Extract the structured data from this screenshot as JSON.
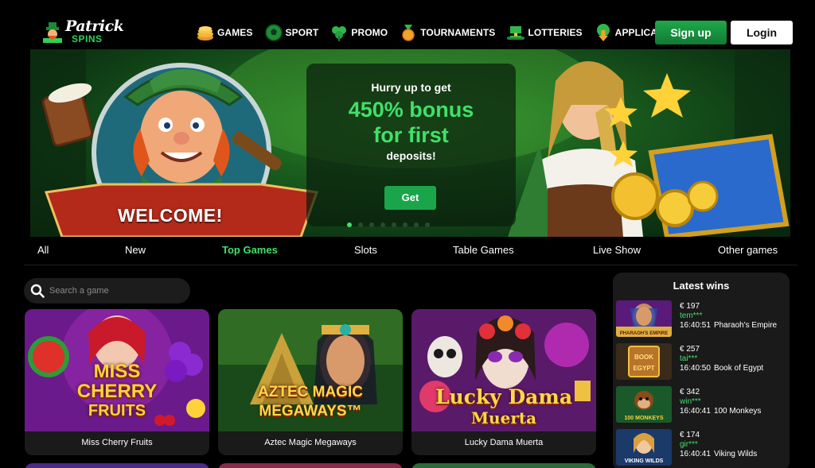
{
  "brand": {
    "logo_line1": "Patrick",
    "logo_line2": "SPINS"
  },
  "nav": [
    {
      "label": "GAMES",
      "icon": "coins-icon"
    },
    {
      "label": "SPORT",
      "icon": "soccer-ball-icon"
    },
    {
      "label": "PROMO",
      "icon": "clover-icon"
    },
    {
      "label": "TOURNAMENTS",
      "icon": "medal-icon"
    },
    {
      "label": "LOTTERIES",
      "icon": "leprechaun-hat-icon"
    },
    {
      "label": "APPLICATION",
      "icon": "download-icon"
    }
  ],
  "auth": {
    "signup": "Sign up",
    "login": "Login"
  },
  "banner": {
    "line1": "Hurry up to get",
    "line2": "450% bonus",
    "line3": "for first",
    "line4": "deposits!",
    "cta": "Get",
    "welcome": "WELCOME!",
    "slides": 8,
    "active_slide": 1
  },
  "categories": [
    "All",
    "New",
    "Top Games",
    "Slots",
    "Table Games",
    "Live Show",
    "Other games"
  ],
  "active_category": "Top Games",
  "search": {
    "placeholder": "Search a game"
  },
  "games": [
    {
      "name": "Miss Cherry Fruits",
      "art_line1": "MISS",
      "art_line2": "CHERRY",
      "art_line3": "FRUITS"
    },
    {
      "name": "Aztec Magic Megaways",
      "art_line1": "AZTEC MAGIC",
      "art_line2": "MEGAWAYS™"
    },
    {
      "name": "Lucky Dama Muerta",
      "art_line1": "Lucky Dama",
      "art_line2": "Muerta"
    }
  ],
  "latest_wins": {
    "title": "Latest wins",
    "items": [
      {
        "amount": "€ 197",
        "user": "tem***",
        "time": "16:40:51",
        "game": "Pharaoh's Empire",
        "thumb_text": "PHARAOH'S EMPIRE"
      },
      {
        "amount": "€ 257",
        "user": "tai***",
        "time": "16:40:50",
        "game": "Book of Egypt",
        "thumb_text": "BOOK OF EGYPT"
      },
      {
        "amount": "€ 342",
        "user": "win***",
        "time": "16:40:41",
        "game": "100 Monkeys",
        "thumb_text": "100 MONKEYS"
      },
      {
        "amount": "€ 174",
        "user": "gir***",
        "time": "16:40:41",
        "game": "Viking Wilds",
        "thumb_text": "VIKING WILDS"
      }
    ]
  },
  "colors": {
    "accent_green": "#41e06a",
    "button_green": "#1aa54a",
    "card_bg": "#1a1a1a",
    "page_bg": "#000000"
  }
}
